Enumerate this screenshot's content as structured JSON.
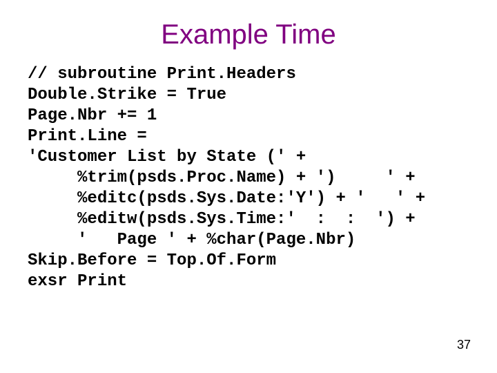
{
  "title": "Example Time",
  "code_lines": [
    "// subroutine Print.Headers",
    "Double.Strike = True",
    "Page.Nbr += 1",
    "Print.Line =",
    "'Customer List by State (' +",
    "     %trim(psds.Proc.Name) + ')     ' +",
    "     %editc(psds.Sys.Date:'Y') + '   ' +",
    "     %editw(psds.Sys.Time:'  :  :  ') +",
    "     '   Page ' + %char(Page.Nbr)",
    "Skip.Before = Top.Of.Form",
    "exsr Print"
  ],
  "page_number": "37"
}
